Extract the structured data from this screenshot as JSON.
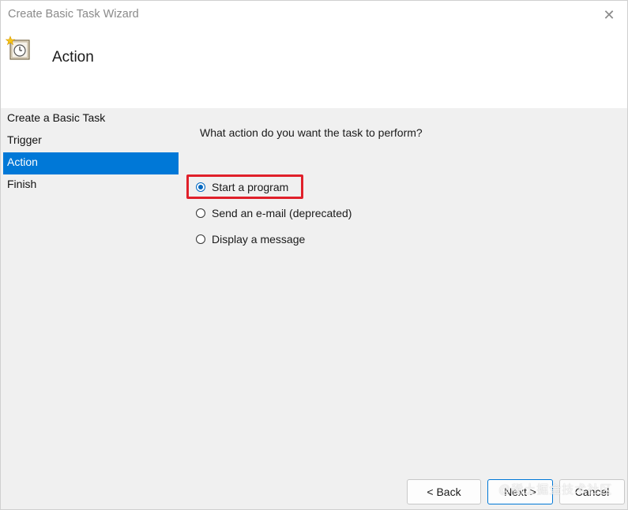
{
  "window": {
    "title": "Create Basic Task Wizard",
    "close_glyph": "✕"
  },
  "header": {
    "title": "Action",
    "icon": "task-scheduler-clock-icon"
  },
  "steps": [
    {
      "label": "Create a Basic Task",
      "selected": false
    },
    {
      "label": "Trigger",
      "selected": false
    },
    {
      "label": "Action",
      "selected": true
    },
    {
      "label": "Finish",
      "selected": false
    }
  ],
  "content": {
    "question": "What action do you want the task to perform?",
    "options": [
      {
        "label": "Start a program",
        "checked": true
      },
      {
        "label": "Send an e-mail (deprecated)",
        "checked": false
      },
      {
        "label": "Display a message",
        "checked": false
      }
    ]
  },
  "buttons": {
    "back": "< Back",
    "next": "Next >",
    "cancel": "Cancel"
  },
  "watermark": "@稀土掘金技术社区",
  "colors": {
    "accent": "#0078d7",
    "highlight": "#e0202a"
  }
}
